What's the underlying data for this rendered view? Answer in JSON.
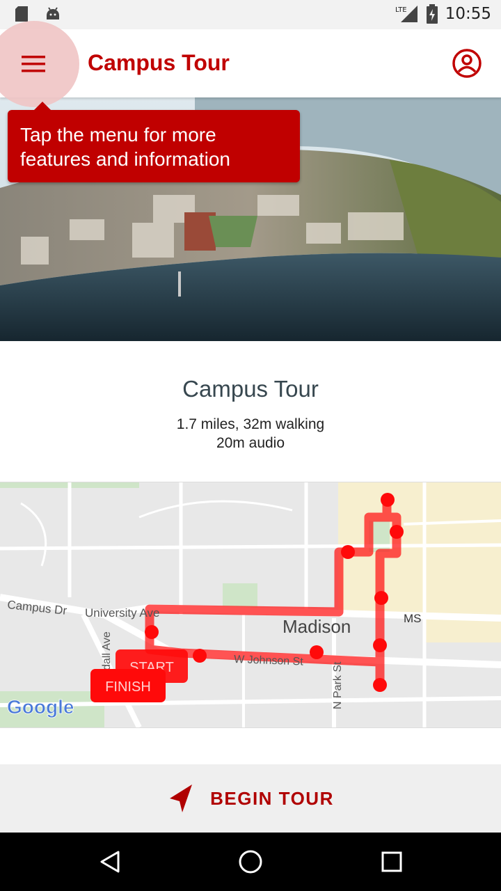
{
  "status_bar": {
    "time": "10:55",
    "network": "LTE",
    "icons": [
      "sd-card-icon",
      "android-icon",
      "signal-icon",
      "battery-charging-icon"
    ]
  },
  "app_bar": {
    "title": "Campus Tour",
    "menu_icon": "hamburger-menu-icon",
    "account_icon": "account-circle-icon"
  },
  "tooltip": {
    "text": "Tap the menu for more features and information"
  },
  "tour": {
    "title": "Campus Tour",
    "stats_line1": "1.7 miles, 32m walking",
    "stats_line2": "20m audio"
  },
  "map": {
    "labels": {
      "campus_dr": "Campus Dr",
      "university_ave": "University Ave",
      "madison": "Madison",
      "ms": "MS",
      "w_johnson_st": "W Johnson St",
      "n_park_st": "N Park St",
      "randall_ave": "dall Ave",
      "start": "START",
      "finish": "FINISH",
      "google": "Google"
    },
    "route_color": "#ff1a1a"
  },
  "begin": {
    "label": "BEGIN TOUR",
    "icon": "navigation-arrow-icon",
    "accent": "#b00000"
  },
  "nav": {
    "back_icon": "back-triangle-icon",
    "home_icon": "home-circle-icon",
    "recents_icon": "recents-square-icon"
  }
}
